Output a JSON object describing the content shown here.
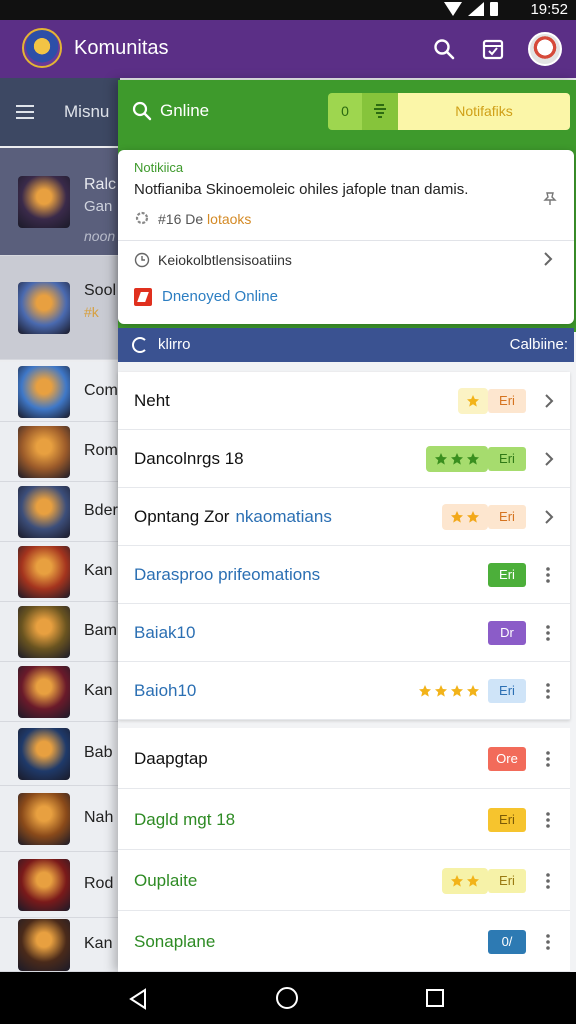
{
  "status_bar": {
    "time": "19:52"
  },
  "app_bar": {
    "title": "Komunitas"
  },
  "background_list": {
    "header_label": "Misnu",
    "items": [
      {
        "title": "Ralc",
        "subtitle": "Gan",
        "meta": "noon"
      },
      {
        "title": "Sool",
        "subtitle": "",
        "meta": "#k"
      },
      {
        "title": "Com"
      },
      {
        "title": "Rom"
      },
      {
        "title": "Bder"
      },
      {
        "title": "Kan"
      },
      {
        "title": "Bam"
      },
      {
        "title": "Kan"
      },
      {
        "title": "Bab"
      },
      {
        "title": "Nah"
      },
      {
        "title": "Rod"
      },
      {
        "title": "Kan"
      }
    ]
  },
  "drawer": {
    "search_label": "Gnline",
    "chips": {
      "a": "0",
      "c": "Notifafiks"
    },
    "notification": {
      "tag": "Notikiica",
      "message": "Notfianiba Skinoemoleic ohiles jafople tnan damis.",
      "sub_prefix": "#16 De",
      "sub_highlight": "lotaoks",
      "row2": "Keiokolbtlensisoatiins",
      "link": "Dnenoyed Online"
    },
    "section_header": {
      "left": "klirro",
      "right": "Calbiine:"
    },
    "items": [
      {
        "label": "Neht",
        "label_color": "#111111",
        "stars": 1,
        "rating_bg": "#fbf3c4",
        "star_color": "#f2b31a",
        "badge": "Eri",
        "badge_bg": "#fde6cf",
        "badge_fg": "#d5731f",
        "action": "chevron"
      },
      {
        "label": "Dancolnrgs 18",
        "label_color": "#111111",
        "stars": 3,
        "rating_bg": "#a6dc6e",
        "star_color": "#3a8f1f",
        "badge": "Eri",
        "badge_bg": "#a6dc6e",
        "badge_fg": "#2f7a17",
        "action": "chevron"
      },
      {
        "label": "Opntang Zor",
        "label_suffix": "nkaomatians",
        "label_color": "#111111",
        "stars": 2,
        "rating_bg": "#fde6cf",
        "star_color": "#f2a81a",
        "badge": "Eri",
        "badge_bg": "#fde6cf",
        "badge_fg": "#d5731f",
        "action": "chevron"
      },
      {
        "label": "Darasproo prifeomations",
        "label_color": "#2b6fb3",
        "stars": 0,
        "badge": "Eri",
        "badge_bg": "#4caf3a",
        "badge_fg": "#ffffff",
        "action": "more"
      },
      {
        "label": "Baiak10",
        "label_color": "#2b6fb3",
        "stars": 0,
        "badge": "Dr",
        "badge_bg": "#8b5cc8",
        "badge_fg": "#ffffff",
        "action": "more"
      },
      {
        "label": "Baioh10",
        "label_color": "#2b6fb3",
        "stars": 4,
        "rating_bg": "#ffffff",
        "star_color": "#f2b31a",
        "badge": "Eri",
        "badge_bg": "#cfe4f8",
        "badge_fg": "#2b6fb3",
        "action": "more"
      }
    ],
    "items2": [
      {
        "label": "Daapgtap",
        "label_color": "#111111",
        "stars": 0,
        "badge": "Ore",
        "badge_bg": "#f26b5a",
        "badge_fg": "#ffffff",
        "action": "more"
      },
      {
        "label": "Dagld mgt 18",
        "label_color": "#2e8b24",
        "stars": 0,
        "badge": "Eri",
        "badge_bg": "#f6c42e",
        "badge_fg": "#7a5a08",
        "action": "more"
      },
      {
        "label": "Ouplaite",
        "label_color": "#2e8b24",
        "stars": 2,
        "rating_bg": "#f6f2a8",
        "star_color": "#f2b31a",
        "badge": "Eri",
        "badge_bg": "#f6f2a8",
        "badge_fg": "#9a7a12",
        "action": "more"
      },
      {
        "label": "Sonaplane",
        "label_color": "#2e8b24",
        "stars": 0,
        "badge": "0/",
        "badge_bg": "#2d7ab3",
        "badge_fg": "#ffffff",
        "action": "more"
      }
    ]
  }
}
